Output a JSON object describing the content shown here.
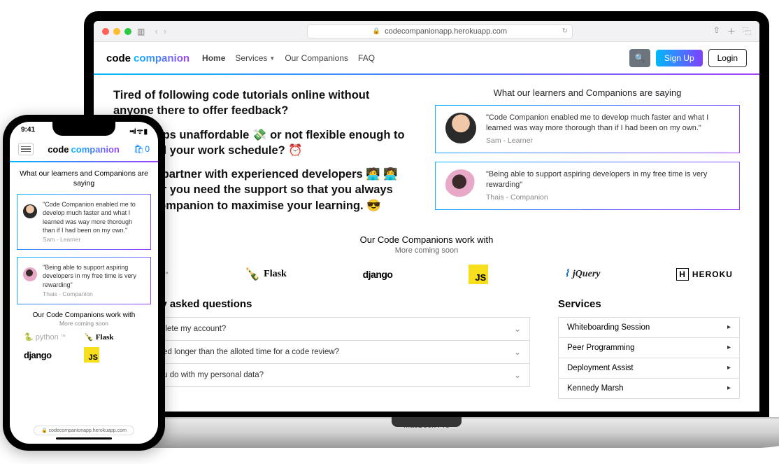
{
  "laptop": {
    "base_label": "MacBook Pro",
    "chrome": {
      "url": "codecompanionapp.herokuapp.com"
    },
    "brand1": "code",
    "brand2": "companion",
    "nav": {
      "home": "Home",
      "services": "Services",
      "companions": "Our Companions",
      "faq": "FAQ"
    },
    "signup": "Sign Up",
    "login": "Login",
    "hero": {
      "p1": "Tired of following code tutorials online without anyone there to offer feedback?",
      "p2": "Bootcamps unaffordable 💸 or not flexible enough to fit around your work schedule? ⏰",
      "p3": "Why not partner with experienced developers 🧑‍💻 👩‍💻 whenever you need the support so that you always have a companion to maximise your learning. 😎"
    },
    "testimonials_heading": "What our learners and Companions are saying",
    "t1_text": "\"Code Companion enabled me to develop much faster and what I learned was way more thorough than if I had been on my own.\"",
    "t1_who": "Sam - Learner",
    "t2_text": "\"Being able to support aspiring developers in my free time is very rewarding\"",
    "t2_who": "Thais - Companion",
    "logos_heading": "Our Code Companions work with",
    "logos_sub": "More coming soon",
    "logo_python": "python",
    "logo_flask": "Flask",
    "logo_django": "django",
    "logo_js": "JS",
    "logo_jquery": "jQuery",
    "logo_heroku": "HEROKU",
    "faq_heading": "Frequently asked questions",
    "faq1": "How do I delete my account?",
    "faq2": "What if I need longer than the alloted time for a code review?",
    "faq3": "What do you do with my personal data?",
    "svc_heading": "Services",
    "svc1": "Whiteboarding Session",
    "svc2": "Peer Programming",
    "svc3": "Deployment Assist",
    "svc4": "Kennedy Marsh"
  },
  "phone": {
    "time": "9:41",
    "brand1": "code",
    "brand2": "companion",
    "cart_count": "0",
    "testimonials_heading": "What our learners and Companions are saying",
    "t1_text": "\"Code Companion enabled me to develop much faster and what I learned was way more thorough than if I had been on my own.\"",
    "t1_who": "Sam - Learner",
    "t2_text": "\"Being able to support aspiring developers in my free time is very rewarding\"",
    "t2_who": "Thais - Companion",
    "logos_heading": "Our Code Companions work with",
    "logos_sub": "More coming soon",
    "logo_python": "python",
    "logo_flask": "Flask",
    "logo_django": "django",
    "logo_js": "JS",
    "url": "codecompanionapp.herokuapp.com"
  }
}
